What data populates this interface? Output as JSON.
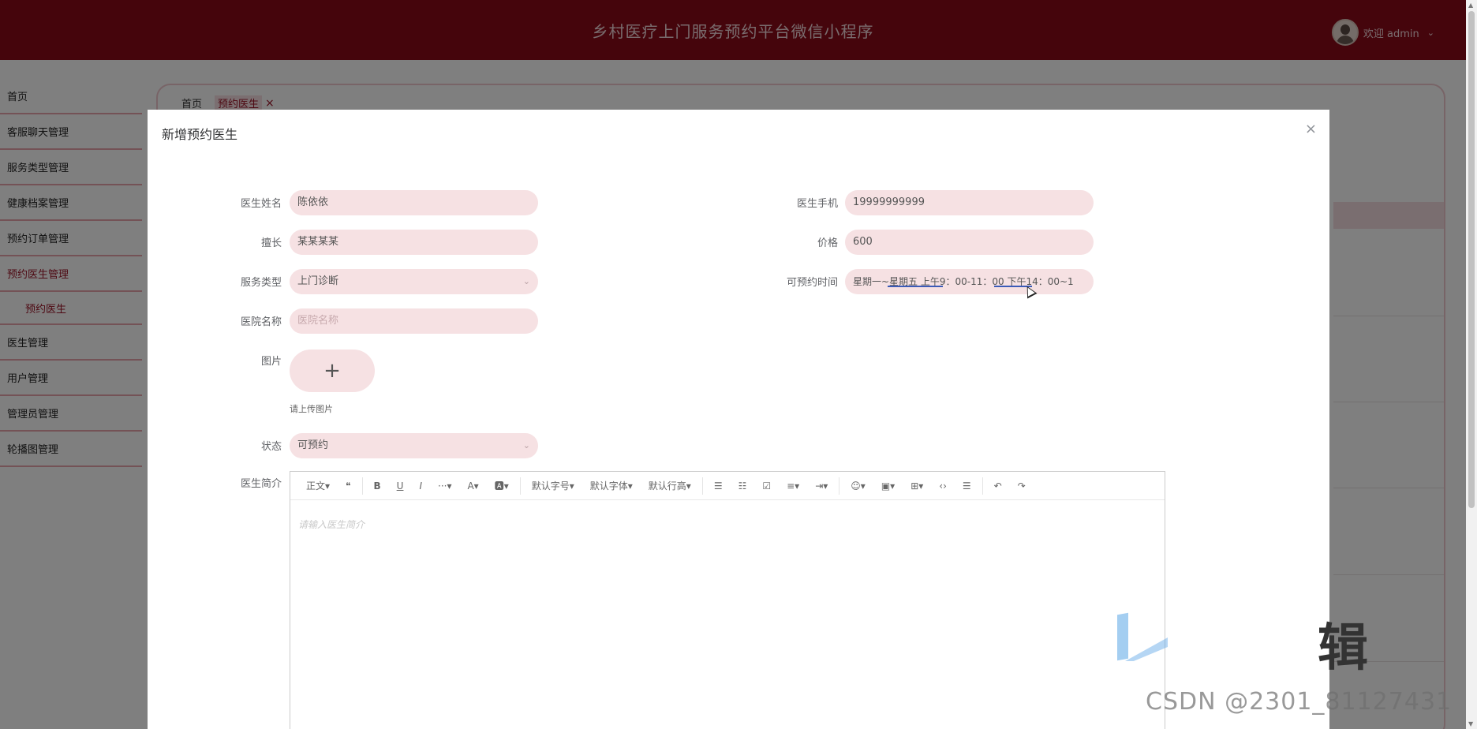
{
  "app": {
    "title": "乡村医疗上门服务预约平台微信小程序",
    "welcome": "欢迎 admin",
    "user_chevron": "⌄"
  },
  "sidebar": {
    "items": [
      {
        "label": "首页"
      },
      {
        "label": "客服聊天管理"
      },
      {
        "label": "服务类型管理"
      },
      {
        "label": "健康档案管理"
      },
      {
        "label": "预约订单管理"
      },
      {
        "label": "预约医生管理"
      },
      {
        "label": "预约医生"
      },
      {
        "label": "医生管理"
      },
      {
        "label": "用户管理"
      },
      {
        "label": "管理员管理"
      },
      {
        "label": "轮播图管理"
      }
    ]
  },
  "breadcrumb": {
    "home": "首页",
    "current": "预约医生",
    "close": "×"
  },
  "modal": {
    "title": "新增预约医生",
    "close": "×",
    "fields": {
      "doctor_name": {
        "label": "医生姓名",
        "value": "陈依依"
      },
      "doctor_phone": {
        "label": "医生手机",
        "value": "19999999999"
      },
      "specialty": {
        "label": "擅长",
        "value": "某某某某"
      },
      "price": {
        "label": "价格",
        "value": "600"
      },
      "service_type": {
        "label": "服务类型",
        "value": "上门诊断"
      },
      "available_time": {
        "label": "可预约时间",
        "value": "星期一~星期五  上午9：00-11：00  下午14：00~1"
      },
      "hospital": {
        "label": "医院名称",
        "placeholder": "医院名称"
      },
      "image": {
        "label": "图片",
        "plus": "+",
        "tip": "请上传图片"
      },
      "status": {
        "label": "状态",
        "value": "可预约"
      },
      "intro": {
        "label": "医生简介",
        "placeholder": "请输入医生简介"
      }
    },
    "select_arrow": "⌄",
    "toolbar": [
      "正文▾",
      "❝",
      "B",
      "U",
      "I",
      "···▾",
      "A▾",
      "🅰▾",
      "默认字号▾",
      "默认字体▾",
      "默认行高▾",
      "☰",
      "☷",
      "☑",
      "≡▾",
      "⇥▾",
      "☺▾",
      "▣▾",
      "⊞▾",
      "‹›",
      "☰",
      "↶",
      "↷"
    ]
  },
  "watermark": {
    "glyph": "辑",
    "text": "CSDN @2301_81127431"
  },
  "colors": {
    "header": "#8a0a18",
    "accent": "#9d1326",
    "input_bg": "#f6e1e3"
  }
}
